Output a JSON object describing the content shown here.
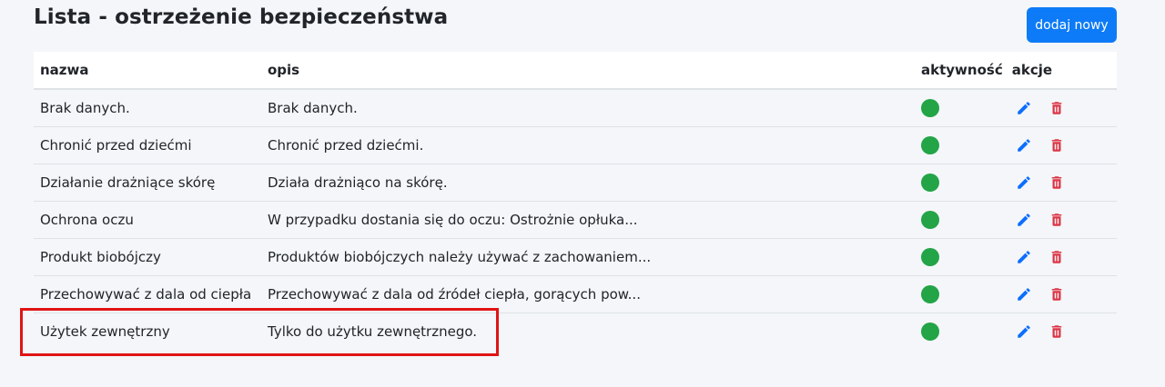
{
  "page": {
    "title": "Lista - ostrzeżenie bezpieczeństwa",
    "add_button_label": "dodaj nowy"
  },
  "table": {
    "headers": {
      "name": "nazwa",
      "description": "opis",
      "active": "aktywność",
      "actions": "akcje"
    },
    "rows": [
      {
        "name": "Brak danych.",
        "description": "Brak danych.",
        "active": true
      },
      {
        "name": "Chronić przed dziećmi",
        "description": "Chronić przed dziećmi.",
        "active": true
      },
      {
        "name": "Działanie drażniące skórę",
        "description": "Działa drażniąco na skórę.",
        "active": true
      },
      {
        "name": "Ochrona oczu",
        "description": "W przypadku dostania się do oczu: Ostrożnie opłuka...",
        "active": true
      },
      {
        "name": "Produkt biobójczy",
        "description": "Produktów biobójczych należy używać z zachowaniem...",
        "active": true
      },
      {
        "name": "Przechowywać z dala od ciepła",
        "description": "Przechowywać z dala od źródeł ciepła, gorących pow...",
        "active": true
      },
      {
        "name": "Użytek zewnętrzny",
        "description": "Tylko do użytku zewnętrznego.",
        "active": true
      }
    ]
  },
  "colors": {
    "accent": "#0d7bf7",
    "active": "#22a447",
    "delete": "#dc3545",
    "edit": "#0d6efd",
    "highlight": "#e01414"
  },
  "icons": {
    "edit": "pencil-icon",
    "delete": "trash-icon",
    "active": "status-dot"
  }
}
